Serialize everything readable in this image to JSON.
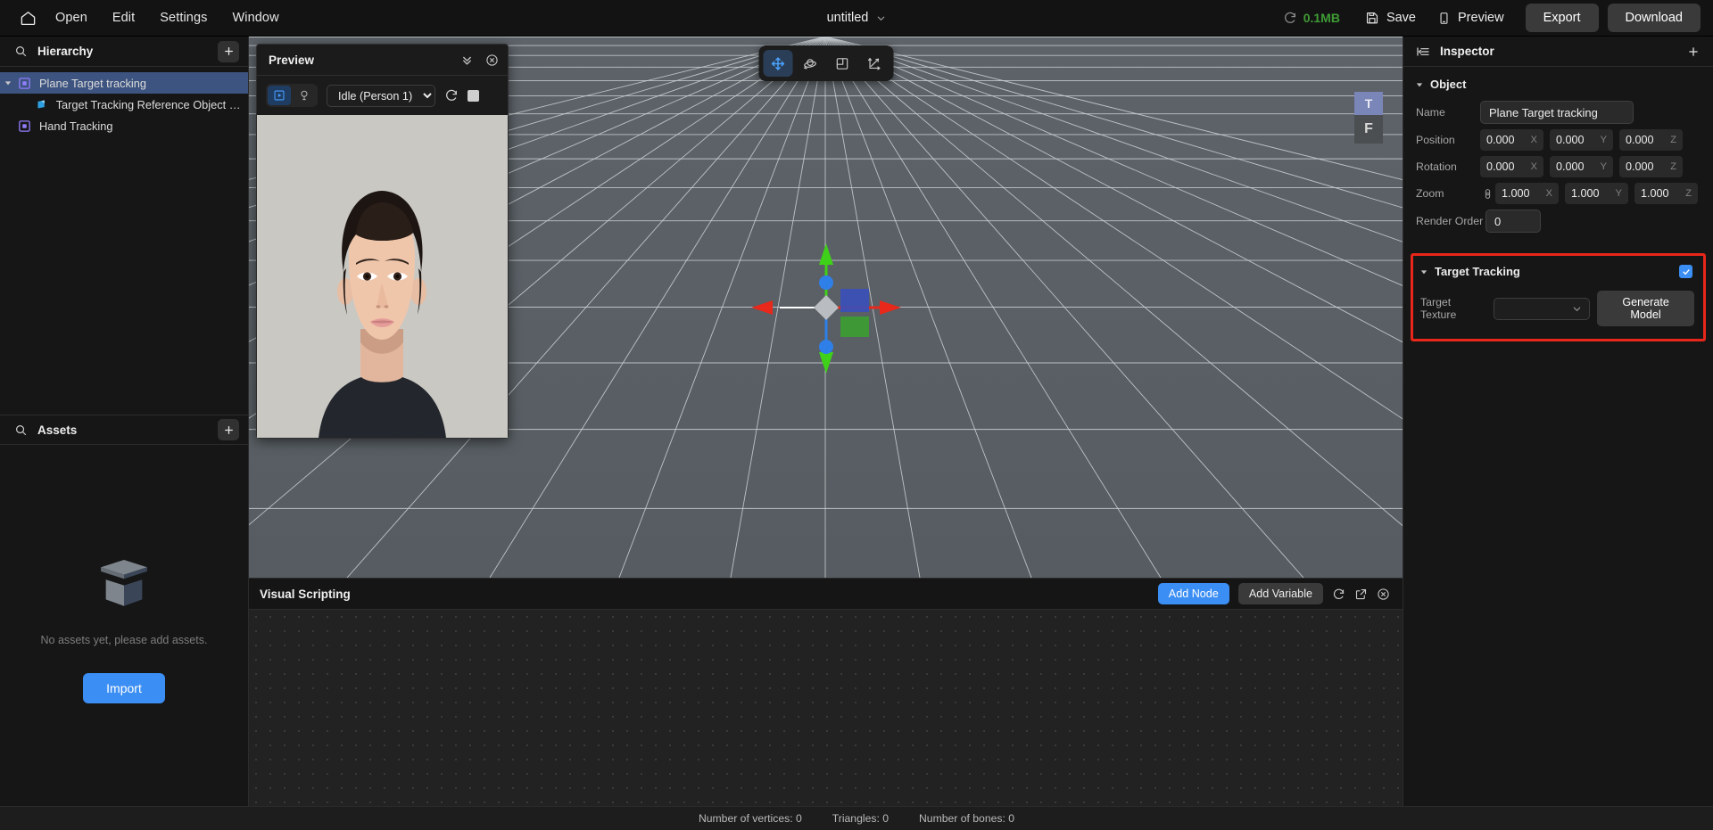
{
  "topbar": {
    "home_icon": "home-icon",
    "menus": [
      "Open",
      "Edit",
      "Settings",
      "Window"
    ],
    "doc_title": "untitled",
    "doc_caret": "chevron-down-icon",
    "memory_refresh_icon": "refresh-icon",
    "memory": "0.1MB",
    "save_icon": "floppy-disk-icon",
    "save_label": "Save",
    "preview_icon": "phone-icon",
    "preview_label": "Preview",
    "export_label": "Export",
    "download_label": "Download",
    "memory_color": "#3f9c35"
  },
  "hierarchy": {
    "search_icon": "search-icon",
    "title": "Hierarchy",
    "add_icon": "plus-icon",
    "nodes": [
      {
        "label": "Plane Target tracking",
        "icon": "node-object-icon",
        "selected": true,
        "depth": 0,
        "expandable": true
      },
      {
        "label": "Target Tracking Reference Object (don'…",
        "icon": "node-plane-icon",
        "selected": false,
        "depth": 1,
        "expandable": false
      },
      {
        "label": "Hand Tracking",
        "icon": "node-object-icon",
        "selected": false,
        "depth": 0,
        "expandable": false
      }
    ]
  },
  "assets": {
    "search_icon": "search-icon",
    "title": "Assets",
    "add_icon": "plus-icon",
    "empty_icon": "empty-box-icon",
    "empty_text": "No assets yet, please add assets.",
    "import_label": "Import",
    "import_color": "#3b8ef3"
  },
  "preview": {
    "title": "Preview",
    "collapse_icon": "chevrons-down-icon",
    "close_icon": "circle-x-icon",
    "mode_play_icon": "play-box-icon",
    "mode_light_icon": "light-bulb-icon",
    "animation_selected": "Idle (Person 1)",
    "animation_options": [
      "Idle (Person 1)"
    ],
    "refresh_icon": "refresh-icon",
    "stop_icon": "stop-square-icon",
    "image_alt": "person-portrait"
  },
  "viewport": {
    "tools": [
      {
        "name": "move-tool",
        "icon": "move-arrows-icon",
        "active": true
      },
      {
        "name": "rotate-tool",
        "icon": "rotate-orbit-icon",
        "active": false
      },
      {
        "name": "scale-tool",
        "icon": "scale-square-icon",
        "active": false
      },
      {
        "name": "transform-tool",
        "icon": "transform-axes-icon",
        "active": false
      }
    ],
    "viewcube": {
      "top_label": "T",
      "front_label": "F"
    },
    "gizmo": "translate-gizmo"
  },
  "visual_scripting": {
    "title": "Visual Scripting",
    "add_node_label": "Add Node",
    "add_variable_label": "Add Variable",
    "refresh_icon": "refresh-icon",
    "popout_icon": "external-link-icon",
    "close_icon": "circle-x-icon",
    "accent_color": "#3b8ef3"
  },
  "inspector": {
    "panel_icon": "inspector-panel-icon",
    "title": "Inspector",
    "add_icon": "plus-icon",
    "object_section": {
      "caret": "caret-down-icon",
      "title": "Object",
      "fields": {
        "name_label": "Name",
        "name_value": "Plane Target tracking",
        "position_label": "Position",
        "position": {
          "x": "0.000",
          "y": "0.000",
          "z": "0.000"
        },
        "rotation_label": "Rotation",
        "rotation": {
          "x": "0.000",
          "y": "0.000",
          "z": "0.000"
        },
        "zoom_label": "Zoom",
        "zoom_lock_icon": "link-lock-icon",
        "zoom": {
          "x": "1.000",
          "y": "1.000",
          "z": "1.000"
        },
        "render_order_label": "Render Order",
        "render_order_value": "0",
        "axis_x": "X",
        "axis_y": "Y",
        "axis_z": "Z"
      }
    },
    "target_tracking_section": {
      "caret": "caret-down-icon",
      "title": "Target Tracking",
      "enabled": true,
      "check_icon": "check-icon",
      "target_texture_label": "Target Texture",
      "target_texture_value": "",
      "target_texture_caret": "chevron-down-icon",
      "generate_model_label": "Generate Model",
      "highlight_color": "#e8271a",
      "checkbox_color": "#3b8ef3"
    }
  },
  "statusbar": {
    "vertices": "Number of vertices: 0",
    "triangles": "Triangles: 0",
    "bones": "Number of bones: 0"
  }
}
